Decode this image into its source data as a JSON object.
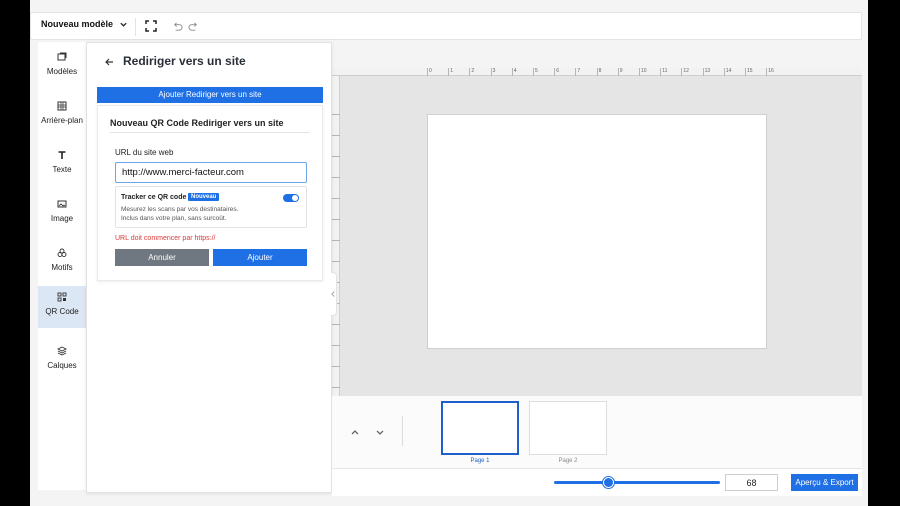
{
  "topbar": {
    "model_label": "Nouveau modèle"
  },
  "tools": [
    {
      "label": "Modèles",
      "icon": "templates-icon"
    },
    {
      "label": "Arrière-plan",
      "icon": "background-icon"
    },
    {
      "label": "Texte",
      "icon": "text-icon"
    },
    {
      "label": "Image",
      "icon": "image-icon"
    },
    {
      "label": "Motifs",
      "icon": "shapes-icon"
    },
    {
      "label": "QR Code",
      "icon": "qr-code-icon",
      "active": true
    },
    {
      "label": "Calques",
      "icon": "layers-icon"
    }
  ],
  "panel": {
    "title": "Rediriger vers un site",
    "add_button": "Ajouter Rediriger vers un site",
    "form_title": "Nouveau QR Code Rediriger vers un site",
    "url_label": "URL du site web",
    "url_value": "http://www.merci-facteur.com",
    "tracker_title": "Tracker ce QR code",
    "tracker_badge": "Nouveau",
    "tracker_desc1": "Mesurez les scans par vos destinataires.",
    "tracker_desc2": "Inclus dans votre plan, sans surcoût.",
    "tracker_enabled": true,
    "error_text": "URL doit commencer par https://",
    "cancel_label": "Annuler",
    "submit_label": "Ajouter"
  },
  "ruler": {
    "ticks": [
      "0",
      "1",
      "2",
      "3",
      "4",
      "5",
      "6",
      "7",
      "8",
      "9",
      "10",
      "11",
      "12",
      "13",
      "14",
      "15",
      "16"
    ]
  },
  "pages": [
    {
      "label": "Page 1",
      "active": true
    },
    {
      "label": "Page 2",
      "active": false
    }
  ],
  "bottombar": {
    "zoom_value": "68",
    "export_label": "Aperçu & Export"
  },
  "colors": {
    "accent": "#1f6fe5",
    "error": "#d93a3a",
    "active_tool_bg": "#dce7f5"
  }
}
